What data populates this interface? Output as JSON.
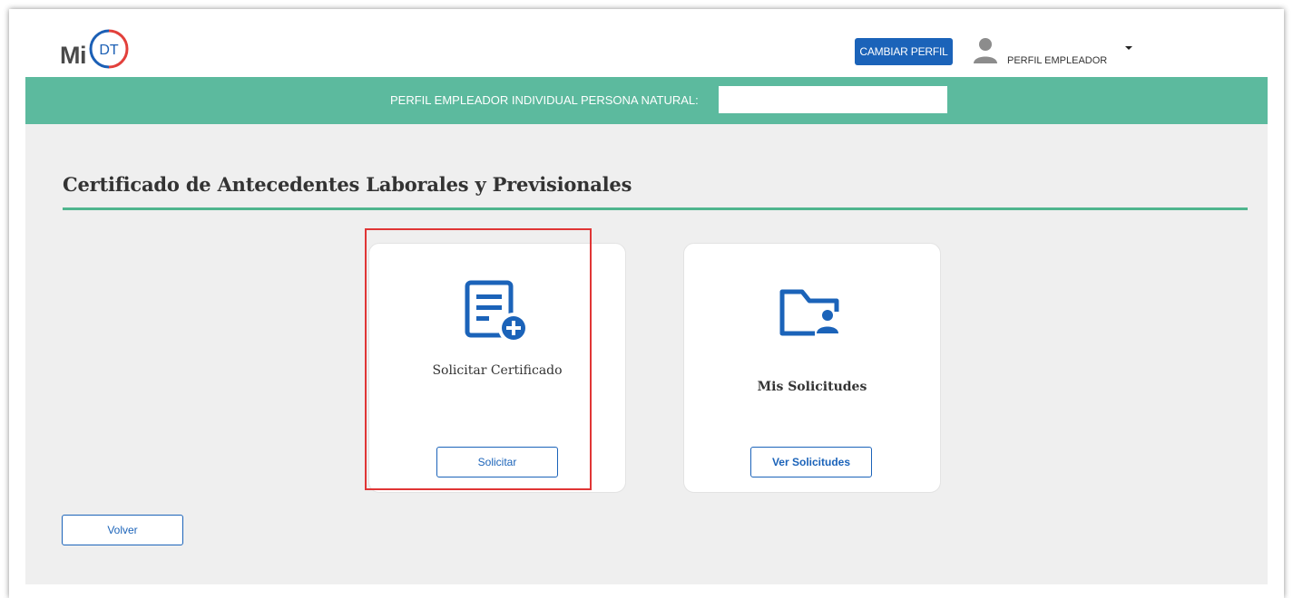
{
  "header": {
    "logo_text": "Mi",
    "logo_badge": "DT",
    "change_profile_label": "CAMBIAR PERFIL",
    "user_label": "PERFIL EMPLEADOR",
    "user_icon": "user-icon",
    "dropdown_icon": "caret-down-icon"
  },
  "banner": {
    "text": "PERFIL EMPLEADOR INDIVIDUAL PERSONA NATURAL:"
  },
  "page": {
    "title": "Certificado de Antecedentes Laborales y Previsionales"
  },
  "cards": [
    {
      "title": "Solicitar Certificado",
      "icon": "document-add-icon",
      "button_label": "Solicitar"
    },
    {
      "title": "Mis Solicitudes",
      "icon": "folder-user-icon",
      "button_label": "Ver Solicitudes"
    }
  ],
  "footer": {
    "back_label": "Volver"
  },
  "colors": {
    "primary_blue": "#1b63b9",
    "banner_green": "#5cba9e",
    "rule_green": "#4fb58e",
    "highlight_red": "#e03535",
    "background": "#efefef"
  }
}
